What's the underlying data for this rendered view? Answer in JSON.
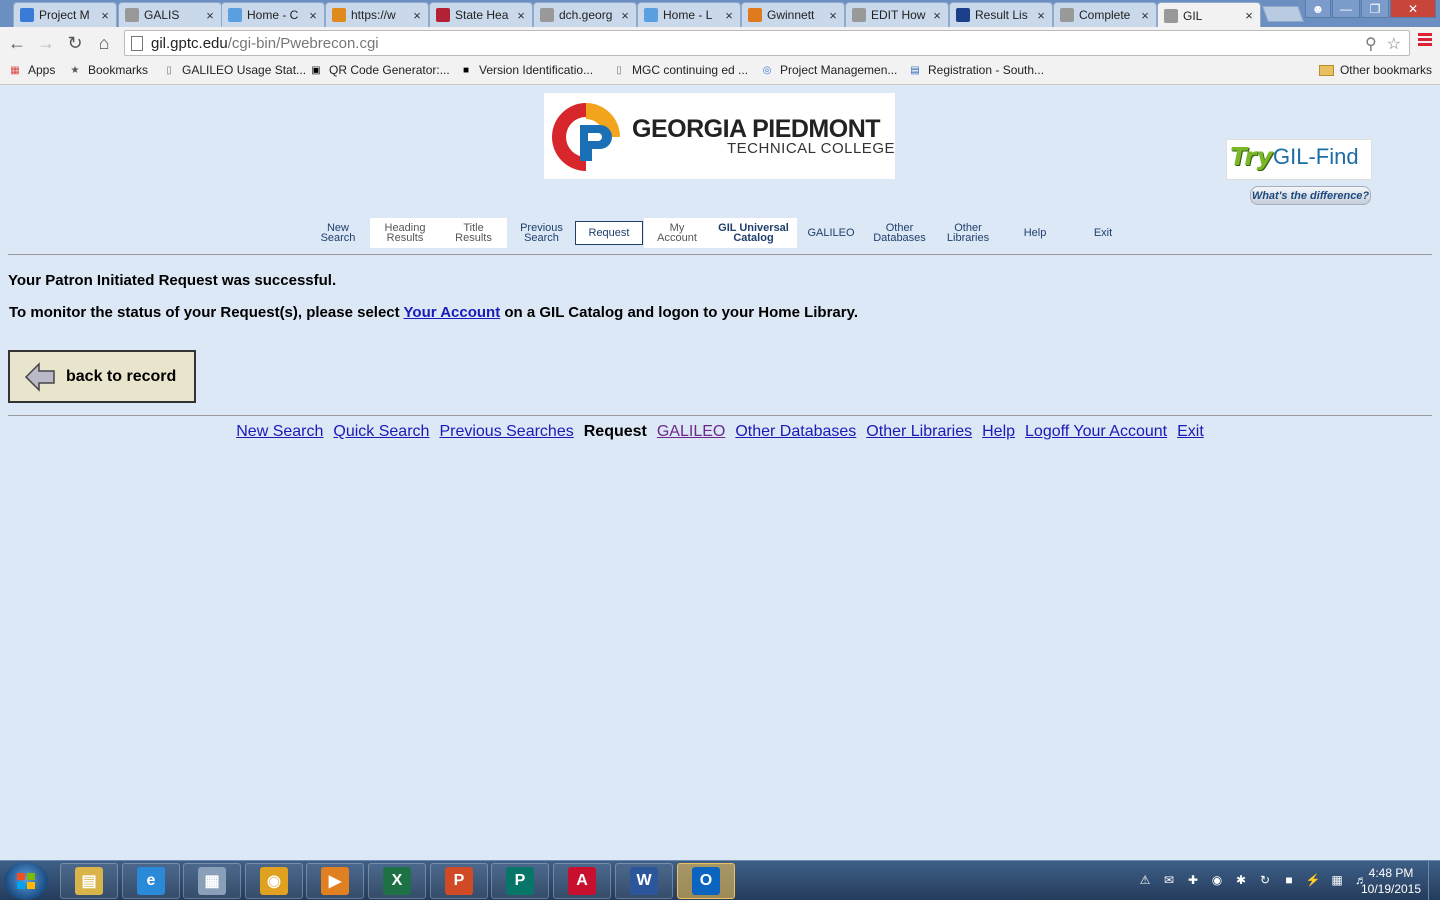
{
  "browser": {
    "tabs": [
      {
        "title": "Project M",
        "icon": "project-icon",
        "color": "#3a7bd5"
      },
      {
        "title": "GALIS",
        "icon": "page-icon",
        "color": "#999999"
      },
      {
        "title": "Home - C",
        "icon": "cloud-icon",
        "color": "#5aa0e0"
      },
      {
        "title": "https://w",
        "icon": "w-icon",
        "color": "#e08a1c"
      },
      {
        "title": "State Hea",
        "icon": "flag-icon",
        "color": "#b22234"
      },
      {
        "title": "dch.georg",
        "icon": "page-icon",
        "color": "#999999"
      },
      {
        "title": "Home - L",
        "icon": "cloud-icon",
        "color": "#5aa0e0"
      },
      {
        "title": "Gwinnett",
        "icon": "question-icon",
        "color": "#e07a1c"
      },
      {
        "title": "EDIT How",
        "icon": "page-icon",
        "color": "#999999"
      },
      {
        "title": "Result Lis",
        "icon": "e-icon",
        "color": "#1c3f8c"
      },
      {
        "title": "Complete",
        "icon": "page-icon",
        "color": "#999999"
      },
      {
        "title": "GIL",
        "icon": "page-icon",
        "color": "#999999"
      }
    ],
    "url_host": "gil.gptc.edu",
    "url_path": "/cgi-bin/Pwebrecon.cgi",
    "bookmarks": [
      {
        "label": "Apps",
        "icon": "apps-icon"
      },
      {
        "label": "Bookmarks",
        "icon": "star-icon"
      },
      {
        "label": "GALILEO Usage Stat...",
        "icon": "page-icon"
      },
      {
        "label": "QR Code Generator:...",
        "icon": "qr-icon"
      },
      {
        "label": "Version Identificatio...",
        "icon": "ise-icon"
      },
      {
        "label": "MGC continuing ed ...",
        "icon": "page-icon"
      },
      {
        "label": "Project Managemen...",
        "icon": "project-icon"
      },
      {
        "label": "Registration - South...",
        "icon": "calendar-icon"
      }
    ],
    "other_bookmarks": "Other bookmarks"
  },
  "header": {
    "logo_line1": "GEORGIA PIEDMONT",
    "logo_line2": "TECHNICAL COLLEGE",
    "gilfind_try": "Try",
    "gilfind_name": "GIL-Find",
    "difference_label": "What's the difference?"
  },
  "nav": [
    {
      "label": "New\nSearch"
    },
    {
      "label": "Heading\nResults"
    },
    {
      "label": "Title\nResults"
    },
    {
      "label": "Previous\nSearch"
    },
    {
      "label": "Request"
    },
    {
      "label": "My\nAccount"
    },
    {
      "label": "GIL Universal\nCatalog"
    },
    {
      "label": "GALILEO"
    },
    {
      "label": "Other\nDatabases"
    },
    {
      "label": "Other\nLibraries"
    },
    {
      "label": "Help"
    },
    {
      "label": "Exit"
    }
  ],
  "content": {
    "success_message": "Your Patron Initiated Request was successful.",
    "monitor_before": "To monitor the status of your Request(s), please select ",
    "monitor_link": "Your Account",
    "monitor_after": " on a GIL Catalog and logon to your Home Library.",
    "back_button": "back to record"
  },
  "footer_links": [
    {
      "label": "New Search",
      "state": "link"
    },
    {
      "label": "Quick Search",
      "state": "link"
    },
    {
      "label": "Previous Searches",
      "state": "link"
    },
    {
      "label": "Request",
      "state": "current"
    },
    {
      "label": "GALILEO",
      "state": "visited"
    },
    {
      "label": "Other Databases",
      "state": "link"
    },
    {
      "label": "Other Libraries",
      "state": "link"
    },
    {
      "label": "Help",
      "state": "link"
    },
    {
      "label": "Logoff Your Account",
      "state": "link"
    },
    {
      "label": "Exit",
      "state": "link"
    }
  ],
  "taskbar": {
    "apps": [
      {
        "name": "file-explorer",
        "glyph": "▤",
        "color": "#d9b44a"
      },
      {
        "name": "internet-explorer",
        "glyph": "e",
        "color": "#2a8ad8"
      },
      {
        "name": "calculator",
        "glyph": "▦",
        "color": "#8aa0b8"
      },
      {
        "name": "chrome",
        "glyph": "◉",
        "color": "#e0a020"
      },
      {
        "name": "media-player",
        "glyph": "▶",
        "color": "#e08020"
      },
      {
        "name": "excel",
        "glyph": "X",
        "color": "#1e7145"
      },
      {
        "name": "powerpoint",
        "glyph": "P",
        "color": "#d04a25"
      },
      {
        "name": "publisher",
        "glyph": "P",
        "color": "#077568"
      },
      {
        "name": "acrobat",
        "glyph": "A",
        "color": "#c8102e"
      },
      {
        "name": "word",
        "glyph": "W",
        "color": "#2b579a"
      },
      {
        "name": "outlook",
        "glyph": "O",
        "color": "#0a64c0"
      }
    ],
    "time": "4:48 PM",
    "date": "10/19/2015"
  }
}
